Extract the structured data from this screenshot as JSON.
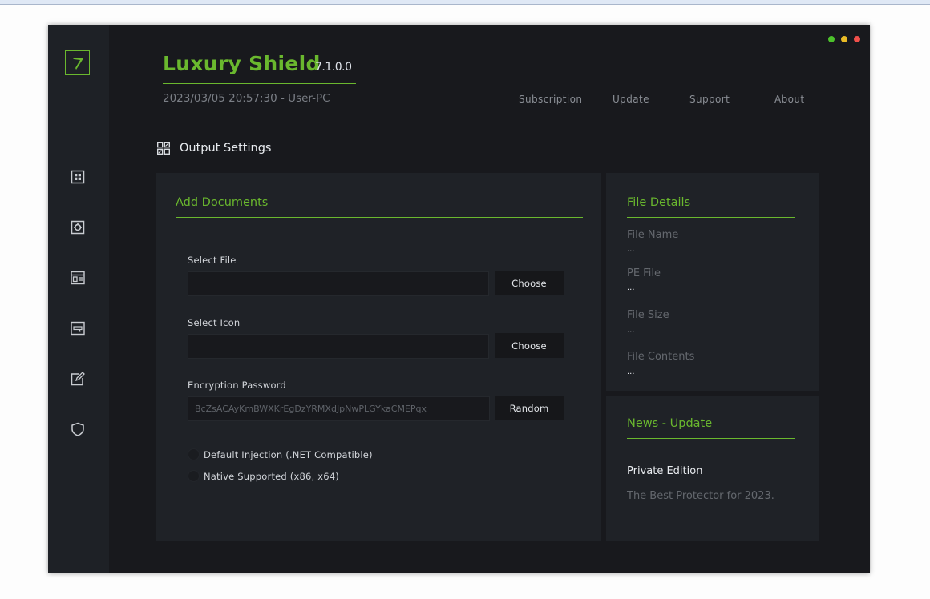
{
  "app": {
    "title": "Luxury Shield",
    "version": "7.1.0.0",
    "datetime_user": "2023/03/05 20:57:30 - User-PC"
  },
  "window_controls": [
    {
      "name": "maximize",
      "color": "#4cc12b"
    },
    {
      "name": "minimize",
      "color": "#e9bb26"
    },
    {
      "name": "close",
      "color": "#f0504b"
    }
  ],
  "top_menu": [
    "Subscription",
    "Update",
    "Support",
    "About"
  ],
  "sidebar": {
    "logo_icon": "arrow-logo",
    "items": [
      {
        "icon": "grid-icon"
      },
      {
        "icon": "gear-icon"
      },
      {
        "icon": "layout-icon"
      },
      {
        "icon": "keyboard-icon"
      },
      {
        "icon": "edit-icon"
      },
      {
        "icon": "shield-icon"
      }
    ]
  },
  "section": {
    "icon": "qr-grid-icon",
    "title": "Output Settings"
  },
  "add_documents": {
    "title": "Add Documents",
    "select_file": {
      "label": "Select File",
      "value": "",
      "button": "Choose"
    },
    "select_icon": {
      "label": "Select Icon",
      "value": "",
      "button": "Choose"
    },
    "encryption_password": {
      "label": "Encryption Password",
      "value": "BcZsACAyKmBWXKrEgDzYRMXdJpNwPLGYkaCMEPqx",
      "button": "Random"
    },
    "options": [
      {
        "label": "Default Injection (.NET Compatible)",
        "selected": false
      },
      {
        "label": "Native Supported (x86, x64)",
        "selected": false
      }
    ]
  },
  "file_details": {
    "title": "File Details",
    "items": [
      {
        "label": "File Name",
        "value": "..."
      },
      {
        "label": "PE File",
        "value": "..."
      },
      {
        "label": "File Size",
        "value": "..."
      },
      {
        "label": "File Contents",
        "value": "..."
      }
    ]
  },
  "news": {
    "title": "News - Update",
    "headline": "Private Edition",
    "text": "The Best Protector for 2023."
  },
  "colors": {
    "accent": "#6ab82e",
    "background": "#18191d",
    "panel": "#1f2227",
    "sidebar": "#1e2126"
  }
}
